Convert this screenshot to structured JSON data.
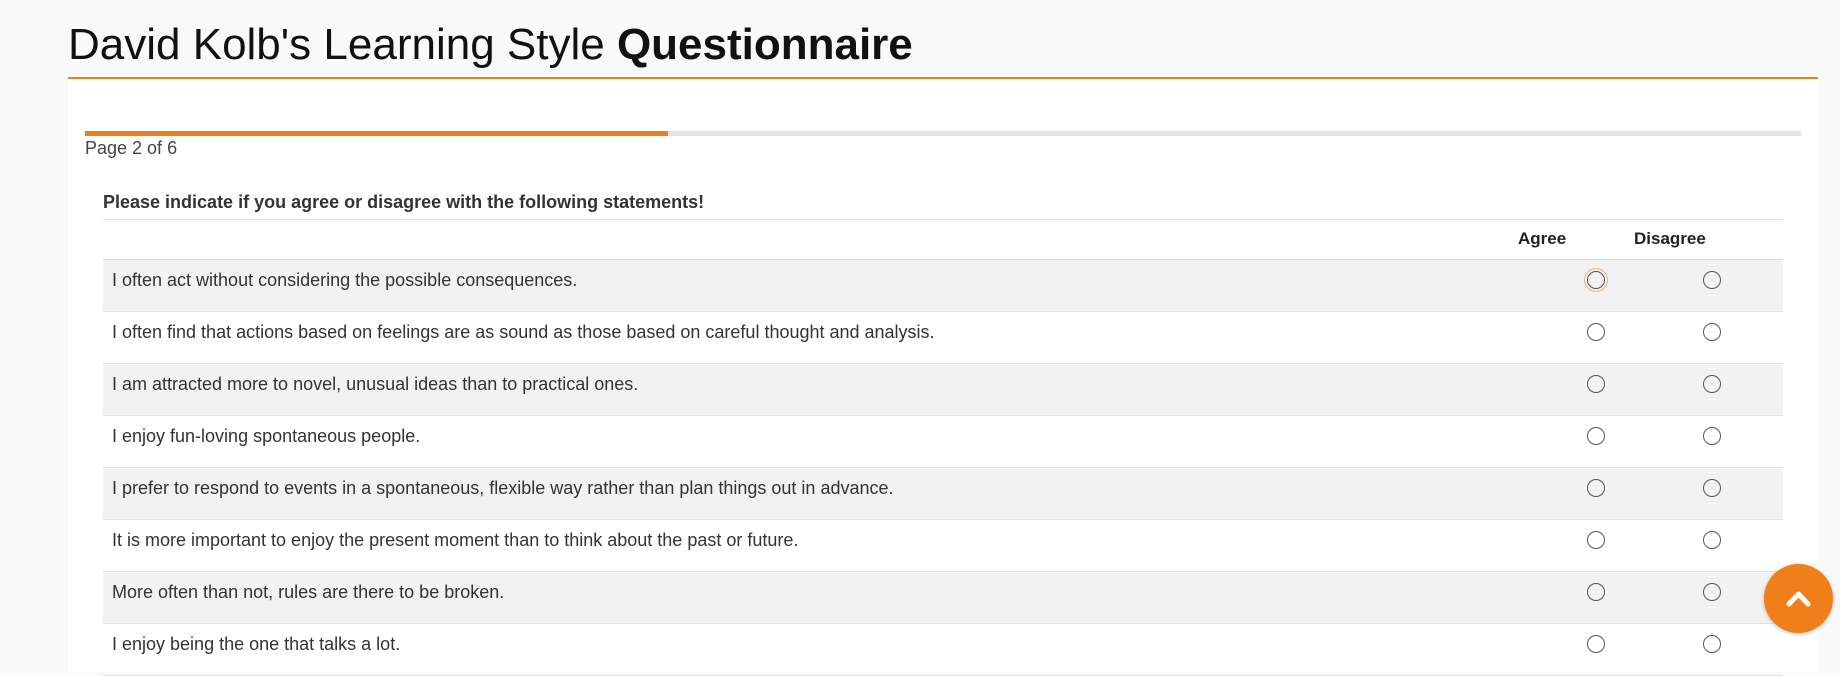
{
  "header": {
    "title_regular": "David Kolb's Learning Style",
    "title_bold": "Questionnaire"
  },
  "progress": {
    "current_page": 2,
    "total_pages": 6,
    "fraction": 0.34,
    "label": "Page 2 of 6"
  },
  "questionnaire": {
    "instructions": "Please indicate if you agree or disagree with the following statements!",
    "columns": [
      "Agree",
      "Disagree"
    ],
    "questions": [
      "I often act without considering the possible consequences.",
      "I often find that actions based on feelings are as sound as those based on careful thought and analysis.",
      "I am attracted more to novel, unusual ideas than to practical ones.",
      "I enjoy fun-loving spontaneous people.",
      "I prefer to respond to events in a spontaneous, flexible way rather than plan things out in advance.",
      "It is more important to enjoy the present moment than to think about the past or future.",
      "More often than not, rules are there to be broken.",
      "I enjoy being the one that talks a lot."
    ]
  },
  "icons": {
    "scroll_top": "chevron-up-icon"
  },
  "colors": {
    "accent": "#f07f1b",
    "row_alt": "#f2f2f2",
    "track": "#e5e5e5"
  }
}
